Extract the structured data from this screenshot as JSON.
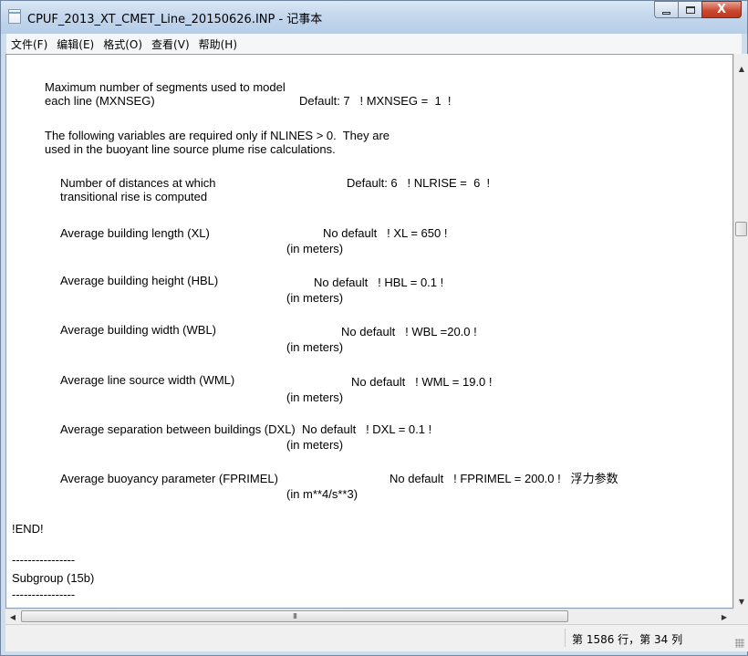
{
  "window": {
    "title": "CPUF_2013_XT_CMET_Line_20150626.INP - 记事本",
    "minimize_glyph": "—",
    "close_glyph": "X"
  },
  "menu": [
    "文件(F)",
    "编辑(E)",
    "格式(O)",
    "查看(V)",
    "帮助(H)"
  ],
  "content": [
    "Maximum number of segments used to model",
    "each line (MXNSEG)",
    "Default: 7   ! MXNSEG =  1  !",
    "The following variables are required only if NLINES > 0.  They are",
    "used in the buoyant line source plume rise calculations.",
    "Number of distances at which",
    "Default: 6   ! NLRISE =  6  !",
    "transitional rise is computed",
    "Average building length (XL)",
    "No default   ! XL = 650 !",
    "(in meters)",
    "Average building height (HBL)",
    "No default   ! HBL = 0.1 !",
    "(in meters)",
    "Average building width (WBL)",
    "No default   ! WBL =20.0 !",
    "(in meters)",
    "Average line source width (WML)",
    "No default   ! WML = 19.0 !",
    "(in meters)",
    "Average separation between buildings (DXL)  No default   ! DXL = 0.1 !",
    "(in meters)",
    "Average buoyancy parameter (FPRIMEL)",
    "No default   ! FPRIMEL = 200.0 !   浮力参数",
    "(in m**4/s**3)",
    "!END!",
    "----------------",
    "Subgroup (15b)",
    "----------------"
  ],
  "scrollbars": {
    "up_arrow": "▲",
    "down_arrow": "▼",
    "left_arrow": "◀",
    "right_arrow": "▶",
    "thumb_grip": "III"
  },
  "status": {
    "position": "第 1586 行，第 34 列"
  }
}
